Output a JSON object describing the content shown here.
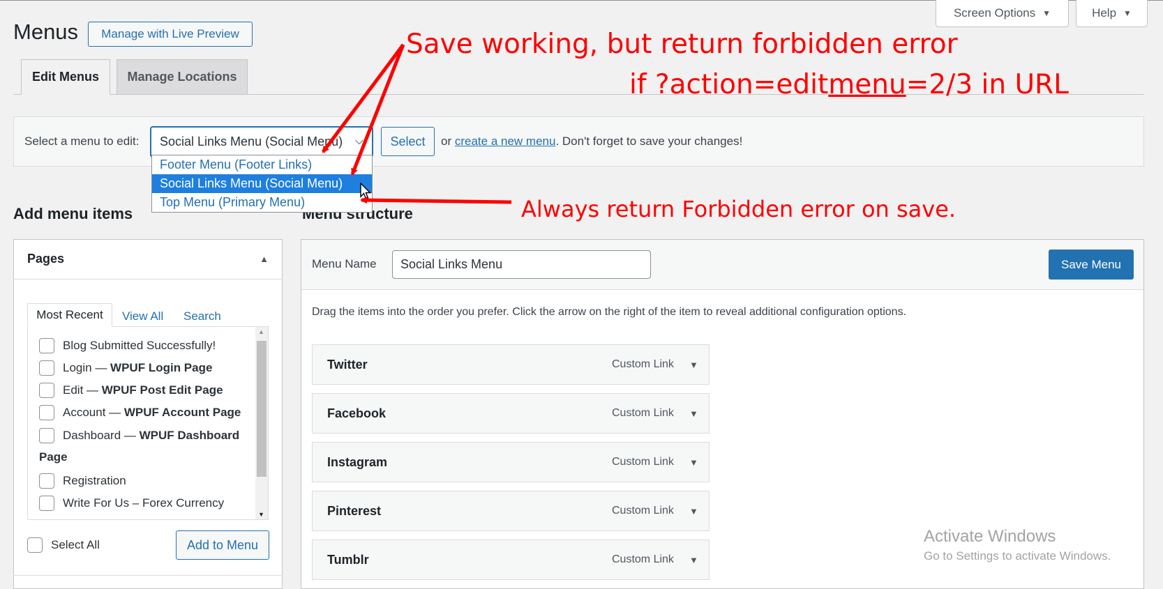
{
  "screen_options": {
    "label": "Screen Options",
    "help": "Help"
  },
  "header": {
    "title": "Menus",
    "live_preview": "Manage with Live Preview"
  },
  "tabs": [
    {
      "label": "Edit Menus"
    },
    {
      "label": "Manage Locations"
    }
  ],
  "select_bar": {
    "label": "Select a menu to edit:",
    "selected": "Social Links Menu (Social Menu)",
    "select_button": "Select",
    "or_text": "or",
    "create_link": "create a new menu",
    "reminder": ". Don't forget to save your changes!"
  },
  "dropdown": {
    "options": [
      "Footer Menu (Footer Links)",
      "Social Links Menu (Social Menu)",
      "Top Menu (Primary Menu)"
    ],
    "selected_index": 1
  },
  "left": {
    "heading": "Add menu items",
    "panel_title": "Pages",
    "tabs": [
      "Most Recent",
      "View All",
      "Search"
    ],
    "items": [
      {
        "text": "Blog Submitted Successfully!",
        "bold": ""
      },
      {
        "text": "Login — ",
        "bold": "WPUF Login Page"
      },
      {
        "text": "Edit — ",
        "bold": "WPUF Post Edit Page"
      },
      {
        "text": "Account — ",
        "bold": "WPUF Account Page"
      },
      {
        "text": "Dashboard — ",
        "bold": "WPUF Dashboard"
      },
      {
        "text": "",
        "bold": "Page"
      },
      {
        "text": "Registration",
        "bold": ""
      },
      {
        "text": "Write For Us – Forex Currency",
        "bold": ""
      }
    ],
    "select_all": "Select All",
    "add_button": "Add to Menu"
  },
  "right": {
    "heading": "Menu structure",
    "name_label": "Menu Name",
    "name_value": "Social Links Menu",
    "save_button": "Save Menu",
    "instructions": "Drag the items into the order you prefer. Click the arrow on the right of the item to reveal additional configuration options.",
    "items": [
      {
        "title": "Twitter",
        "type": "Custom Link"
      },
      {
        "title": "Facebook",
        "type": "Custom Link"
      },
      {
        "title": "Instagram",
        "type": "Custom Link"
      },
      {
        "title": "Pinterest",
        "type": "Custom Link"
      },
      {
        "title": "Tumblr",
        "type": "Custom Link"
      }
    ]
  },
  "watermark": {
    "title": "Activate Windows",
    "subtitle": "Go to Settings to activate Windows."
  },
  "annotations": {
    "line1": "Save working, but return forbidden error",
    "line2_a": "if ?action=edit",
    "line2_b": "menu",
    "line2_c": "=2/3 in URL",
    "line3": "Always return Forbidden error on save.",
    "color": "#ff0000"
  }
}
